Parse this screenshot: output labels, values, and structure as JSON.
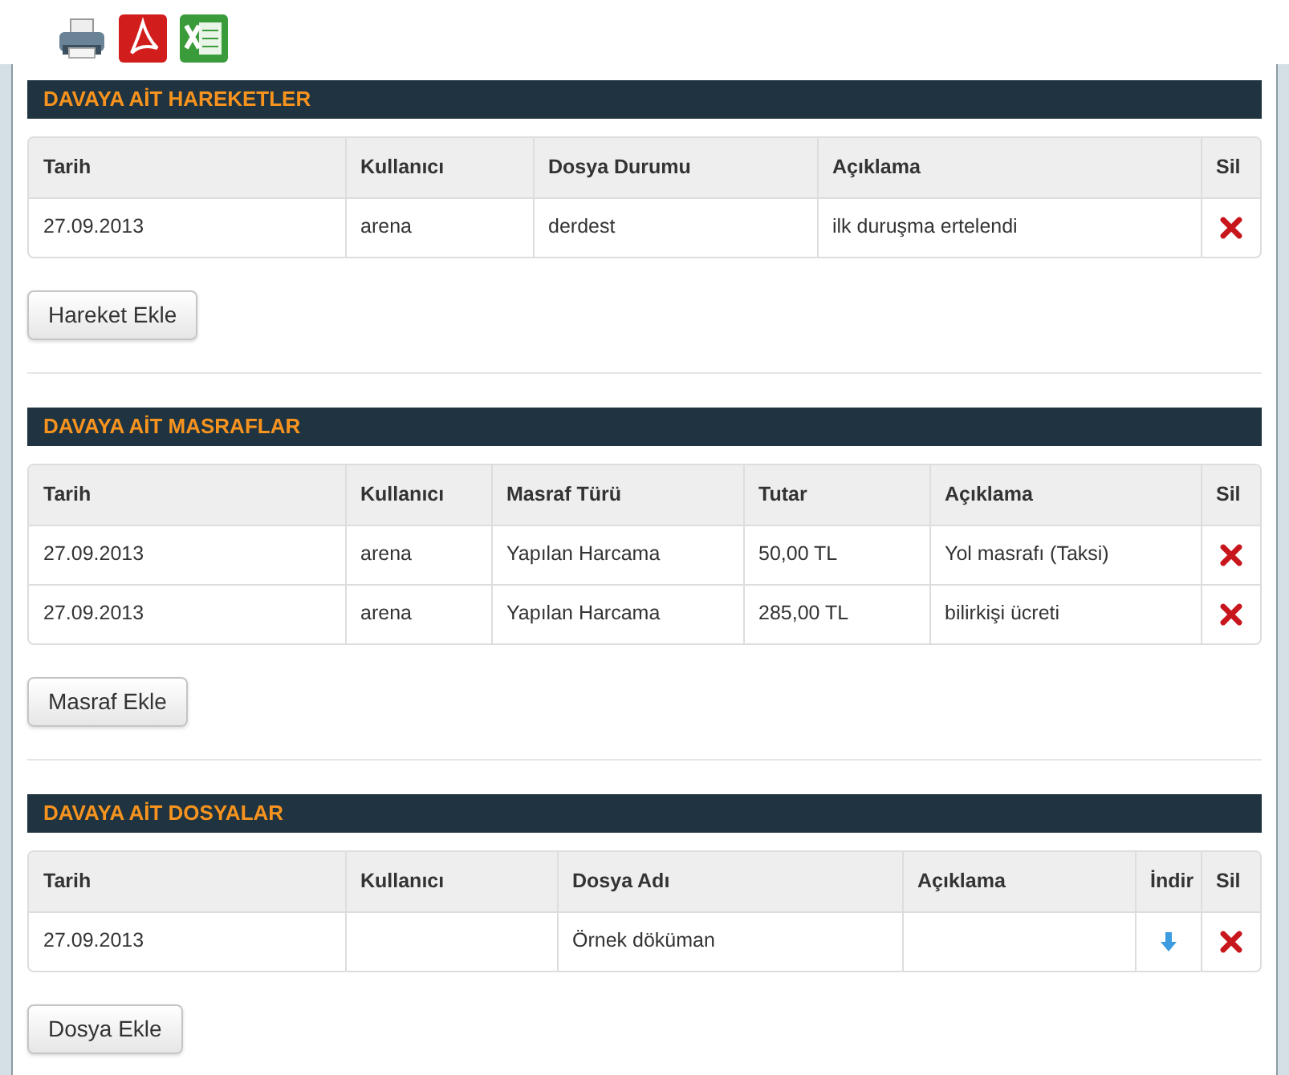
{
  "sections": [
    {
      "title": "DAVAYA AİT HAREKETLER",
      "columns": [
        {
          "label": "Tarih",
          "kind": "text"
        },
        {
          "label": "Kullanıcı",
          "kind": "text"
        },
        {
          "label": "Dosya Durumu",
          "kind": "text"
        },
        {
          "label": "Açıklama",
          "kind": "text"
        },
        {
          "label": "Sil",
          "kind": "delete"
        }
      ],
      "rows": [
        {
          "cells": [
            "27.09.2013",
            "arena",
            "derdest",
            "ilk duruşma ertelendi",
            null
          ]
        }
      ],
      "button": "Hareket Ekle"
    },
    {
      "title": "DAVAYA AİT MASRAFLAR",
      "columns": [
        {
          "label": "Tarih",
          "kind": "text"
        },
        {
          "label": "Kullanıcı",
          "kind": "text"
        },
        {
          "label": "Masraf Türü",
          "kind": "text"
        },
        {
          "label": "Tutar",
          "kind": "text"
        },
        {
          "label": "Açıklama",
          "kind": "text"
        },
        {
          "label": "Sil",
          "kind": "delete"
        }
      ],
      "rows": [
        {
          "cells": [
            "27.09.2013",
            "arena",
            "Yapılan Harcama",
            "50,00 TL",
            "Yol masrafı (Taksi)",
            null
          ]
        },
        {
          "cells": [
            "27.09.2013",
            "arena",
            "Yapılan Harcama",
            "285,00 TL",
            "bilirkişi ücreti",
            null
          ]
        }
      ],
      "button": "Masraf Ekle"
    },
    {
      "title": "DAVAYA AİT DOSYALAR",
      "columns": [
        {
          "label": "Tarih",
          "kind": "text"
        },
        {
          "label": "Kullanıcı",
          "kind": "text"
        },
        {
          "label": "Dosya Adı",
          "kind": "text"
        },
        {
          "label": "Açıklama",
          "kind": "text"
        },
        {
          "label": "İndir",
          "kind": "download"
        },
        {
          "label": "Sil",
          "kind": "delete"
        }
      ],
      "rows": [
        {
          "cells": [
            "27.09.2013",
            null,
            "Örnek döküman",
            null,
            null,
            null
          ]
        }
      ],
      "button": "Dosya Ekle"
    }
  ]
}
